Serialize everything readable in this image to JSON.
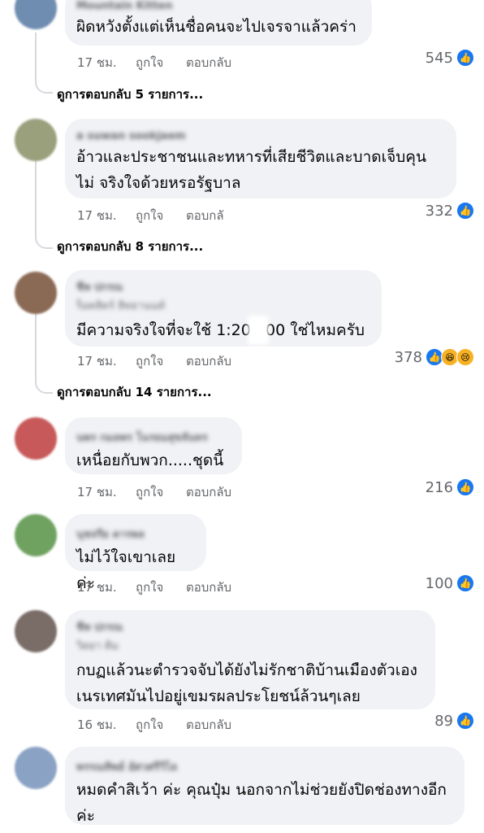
{
  "comments": [
    {
      "text": "ผิดหวังตั้งแต่เห็นชื่อคนจะไปเจรจาแล้วคร่า",
      "author": "Mountain Kitten",
      "time": "17 ชม.",
      "like_label": "ถูกใจ",
      "reply_label": "ตอบกลับ",
      "reaction_count": "545",
      "view_replies": "ดูการตอบกลับ 5 รายการ...",
      "avatar_color": "#6f8db0"
    },
    {
      "text": "อ้าวและประชาชนและทหารที่เสียชีวิตและบาดเจ็บคุนไม่ จริงใจด้วยหรอรัฐบาล",
      "author": "a suwan sookjaem",
      "time": "17 ชม.",
      "like_label": "ถูกใจ",
      "reply_label": "ตอบกลั",
      "reaction_count": "332",
      "view_replies": "ดูการตอบกลับ 8 รายการ...",
      "avatar_color": "#9a9f7c"
    },
    {
      "text": "มีความจริงใจที่จะใช้ 1:20 000 ใช่ไหมครับ",
      "author": "ชีพ ปกรณ",
      "author_line2": "ร็อคสิตร์ สิทธานนท์",
      "time": "17 ชม.",
      "like_label": "ถูกใจ",
      "reply_label": "ตอบกลับ",
      "reaction_count": "378",
      "view_replies": "ดูการตอบกลับ 14 รายการ...",
      "avatar_color": "#8b6a55"
    },
    {
      "text": "เหนื่อยกับพวก.....ชุดนี้",
      "author": "นพร กมลพร โนรธมสุขจันทร",
      "time": "17 ชม.",
      "like_label": "ถูกใจ",
      "reply_label": "ตอบกลับ",
      "reaction_count": "216",
      "avatar_color": "#c7595a"
    },
    {
      "text": "ไม่ไว้ใจเขาเลยค่ะ",
      "author": "นุชจรีย คารพล",
      "time": "17 ชม.",
      "like_label": "ถูกใจ",
      "reply_label": "ตอบกลับ",
      "reaction_count": "100",
      "avatar_color": "#6fa261"
    },
    {
      "text": "กบฏแล้วนะตำรวจจับได้ยังไม่รักชาติบ้านเมืองตัวเอง เนรเทศมันไปอยู่เขมรผลประโยชน์ล้วนๆเลย",
      "author": "ชีพ ปกรณ",
      "author_line2": "วิตยา คิม",
      "time": "16 ชม.",
      "like_label": "ถูกใจ",
      "reply_label": "ตอบกลับ",
      "reaction_count": "89",
      "avatar_color": "#7a6d68"
    },
    {
      "text": "หมดคำสิเว้า ค่ะ คุณปุ๋ม นอกจากไม่ช่วยยังปิดช่องทางอีก ค่ะ",
      "author": "พรรณทิพย์ อัศวศรีวิไล",
      "avatar_color": "#8aa2c4"
    }
  ],
  "icons": {
    "like": "like-icon",
    "haha": "haha-icon",
    "sad": "sad-icon"
  }
}
